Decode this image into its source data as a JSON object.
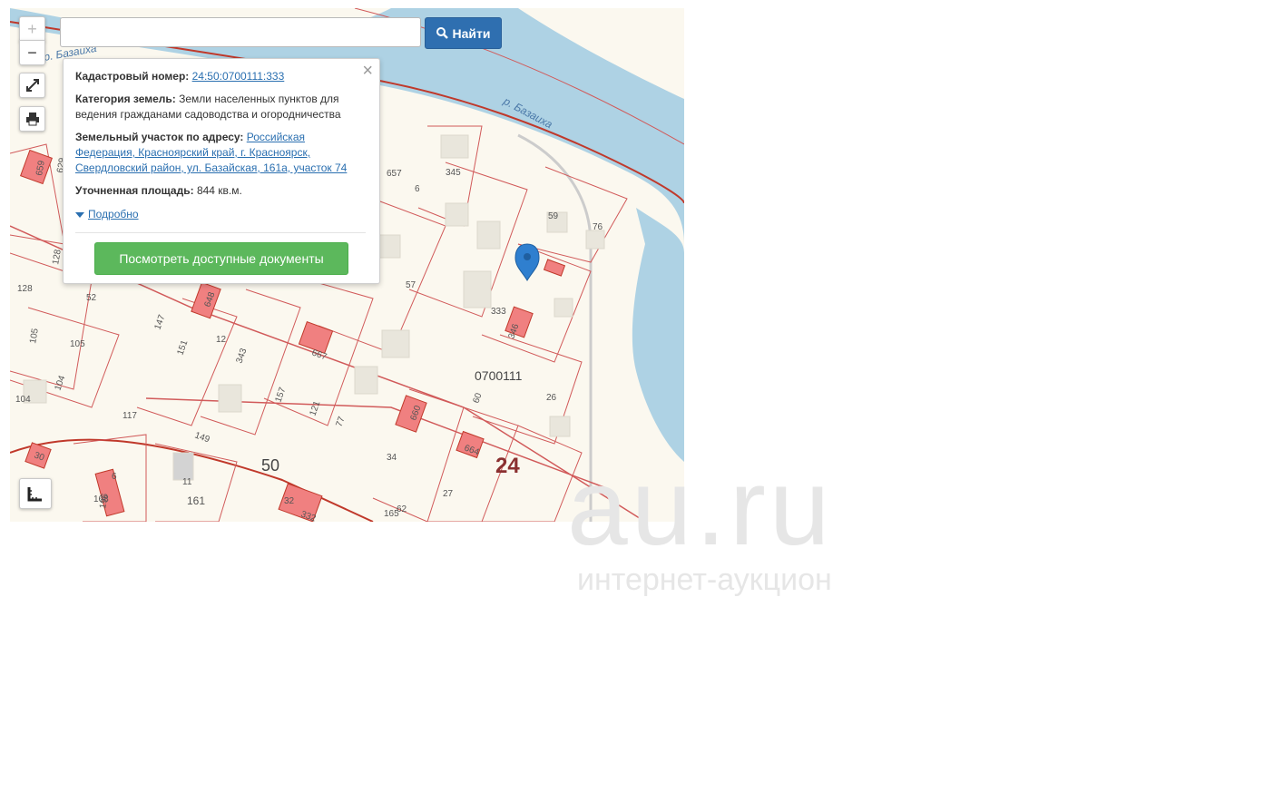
{
  "search": {
    "placeholder": "",
    "button_label": "Найти"
  },
  "controls": {
    "zoom_in": "+",
    "zoom_out": "−"
  },
  "popup": {
    "cadastral_label": "Кадастровый номер:",
    "cadastral_value": "24:50:0700111:333",
    "category_label": "Категория земель:",
    "category_value": "Земли населенных пунктов для ведения гражданами садоводства и огородничества",
    "address_label": "Земельный участок по адресу:",
    "address_value": "Российская Федерация, Красноярский край, г. Красноярск, Свердловский район, ул. Базайская, 161а, участок 74",
    "area_label": "Уточненная площадь:",
    "area_value": "844 кв.м.",
    "details_link": "Подробно",
    "docs_button": "Посмотреть доступные документы",
    "close": "×"
  },
  "map": {
    "river_labels": [
      "р. Базаиха",
      "р. Базаиха"
    ],
    "block_label": "0700111",
    "quarter_labels": [
      "24",
      "50"
    ],
    "parcel_labels": [
      "659",
      "629",
      "657",
      "345",
      "6",
      "59",
      "76",
      "57",
      "333",
      "346",
      "128",
      "52",
      "128",
      "648",
      "105",
      "105",
      "147",
      "151",
      "12",
      "343",
      "667",
      "157",
      "121",
      "77",
      "104",
      "104",
      "117",
      "149",
      "60",
      "26",
      "660",
      "34",
      "664",
      "30",
      "6",
      "11",
      "161",
      "32",
      "332",
      "27",
      "165",
      "62",
      "196",
      "168"
    ]
  },
  "watermark": {
    "brand": "au.ru",
    "tagline": "интернет-аукцион"
  }
}
